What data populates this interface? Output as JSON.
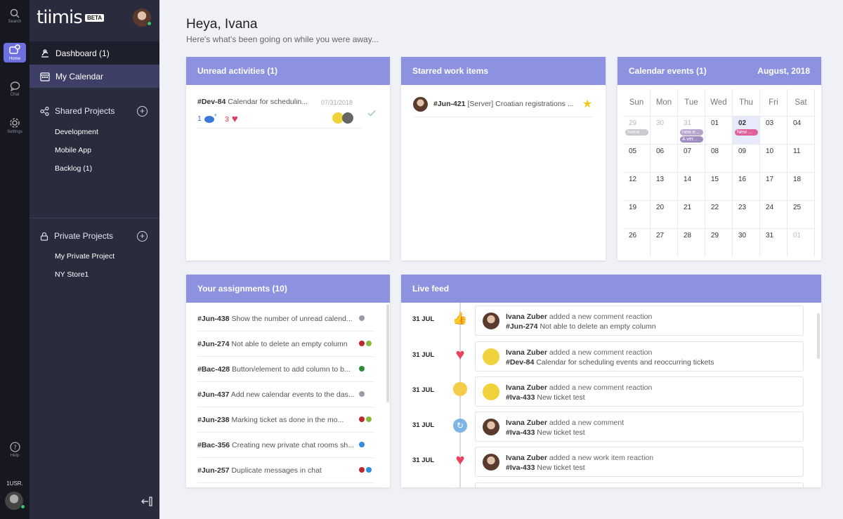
{
  "rail": {
    "search": "Search",
    "home": "Home",
    "chat": "Chat",
    "settings": "Settings",
    "help": "Help",
    "user_label": "1USR."
  },
  "sidebar": {
    "brand": "tiimis",
    "beta": "BETA",
    "dashboard": "Dashboard (1)",
    "my_calendar": "My Calendar",
    "shared_projects": "Shared Projects",
    "shared_items": [
      "Development",
      "Mobile App",
      "Backlog (1)"
    ],
    "private_projects": "Private Projects",
    "private_items": [
      "My Private Project",
      "NY Store1"
    ],
    "collapse_icon": "collapse-sidebar-icon"
  },
  "header": {
    "greeting": "Heya, Ivana",
    "subtitle": "Here's what's been going on while you were away..."
  },
  "unread": {
    "title": "Unread activities (1)",
    "item": {
      "id": "#Dev-84",
      "text": "Calendar for schedulin...",
      "date": "07/31/2018",
      "likes": "1",
      "hearts": "3"
    }
  },
  "starred": {
    "title": "Starred work items",
    "item": {
      "id": "#Jun-421",
      "text": "[Server] Croatian registrations ..."
    }
  },
  "calendar": {
    "title": "Calendar events (1)",
    "month": "August, 2018",
    "days": [
      "Sun",
      "Mon",
      "Tue",
      "Wed",
      "Thu",
      "Fri",
      "Sat"
    ],
    "weeks": [
      [
        "29",
        "30",
        "31",
        "01",
        "02",
        "03",
        "04"
      ],
      [
        "05",
        "06",
        "07",
        "08",
        "09",
        "10",
        "11"
      ],
      [
        "12",
        "13",
        "14",
        "15",
        "16",
        "17",
        "18"
      ],
      [
        "19",
        "20",
        "21",
        "22",
        "23",
        "24",
        "25"
      ],
      [
        "26",
        "27",
        "28",
        "29",
        "30",
        "31",
        "01"
      ]
    ],
    "events": {
      "sun29": "Ivana ...",
      "tue31a": "new e...",
      "tue31b": "A ver...",
      "thu02": "New ..."
    }
  },
  "assignments": {
    "title": "Your assignments (10)",
    "items": [
      {
        "id": "#Jun-438",
        "text": "Show the number of unread calend...",
        "dots": [
          "#9a9ca8"
        ]
      },
      {
        "id": "#Jun-274",
        "text": "Not able to delete an empty column",
        "dots": [
          "#c0272d",
          "#8bb83a"
        ]
      },
      {
        "id": "#Bac-428",
        "text": "Button/element to add column to b...",
        "dots": [
          "#2e8b3a"
        ]
      },
      {
        "id": "#Jun-437",
        "text": "Add new calendar events to the das...",
        "dots": [
          "#9a9ca8"
        ]
      },
      {
        "id": "#Jun-238",
        "text": "Marking ticket as done in the mo...",
        "dots": [
          "#c0272d",
          "#8bb83a"
        ]
      },
      {
        "id": "#Bac-356",
        "text": "Creating new private chat rooms sh...",
        "dots": [
          "#2e8fe0"
        ]
      },
      {
        "id": "#Jun-257",
        "text": "Duplicate messages in chat",
        "dots": [
          "#c0272d",
          "#2e8fe0"
        ]
      }
    ]
  },
  "feed": {
    "title": "Live feed",
    "items": [
      {
        "date": "31 JUL",
        "icon": "thumbs-up-icon",
        "user": "Ivana Zuber",
        "action": "added a new comment reaction",
        "id": "#Jun-274",
        "text": "Not able to delete an empty column"
      },
      {
        "date": "31 JUL",
        "icon": "heart-icon",
        "user": "Ivana Zuber",
        "action": "added a new comment reaction",
        "id": "#Dev-84",
        "text": "Calendar for scheduling events and reoccurring tickets"
      },
      {
        "date": "31 JUL",
        "icon": "thinking-face-icon",
        "user": "Ivana Zuber",
        "action": "added a new comment reaction",
        "id": "#Iva-433",
        "text": "New ticket test"
      },
      {
        "date": "31 JUL",
        "icon": "refresh-comment-icon",
        "user": "Ivana Zuber",
        "action": "added a new comment",
        "id": "#Iva-433",
        "text": "New ticket test"
      },
      {
        "date": "31 JUL",
        "icon": "heart-icon",
        "user": "Ivana Zuber",
        "action": "added a new work item reaction",
        "id": "#Iva-433",
        "text": "New ticket test"
      }
    ]
  },
  "colors": {
    "accent": "#8d92e0",
    "sidebar": "#2a2b3d",
    "rail": "#16171f"
  }
}
